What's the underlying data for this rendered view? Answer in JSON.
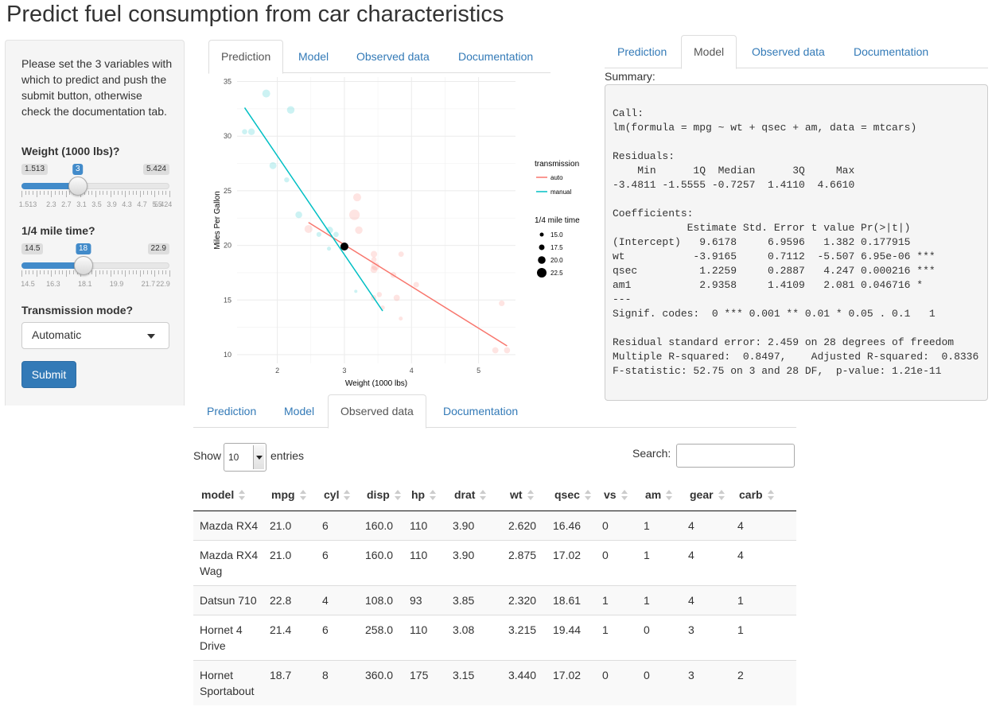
{
  "title": "Predict fuel consumption from car characteristics",
  "sidebar": {
    "intro": "Please set the 3 variables with which to predict and push the submit button, otherwise check the documentation tab.",
    "weight": {
      "label": "Weight (1000 lbs)?",
      "min": 1.513,
      "max": 5.424,
      "value": 3,
      "min_label": "1.513",
      "max_label": "5.424",
      "value_label": "3",
      "grid_labels": [
        "1.513",
        "2.3",
        "2.7",
        "3.1",
        "3.5",
        "3.9",
        "4.3",
        "4.7",
        "5.5",
        "5.424"
      ],
      "grid_positions": [
        1.513,
        2.3,
        2.7,
        3.1,
        3.5,
        3.9,
        4.3,
        4.7,
        5.1,
        5.424
      ]
    },
    "qsec": {
      "label": "1/4 mile time?",
      "min": 14.5,
      "max": 22.9,
      "value": 18,
      "min_label": "14.5",
      "max_label": "22.9",
      "value_label": "18",
      "grid_labels": [
        "14.5",
        "16.3",
        "18.1",
        "19.9",
        "21.7",
        "22.9"
      ],
      "grid_positions": [
        14.5,
        16.3,
        18.1,
        19.9,
        21.7,
        22.9
      ]
    },
    "transmission": {
      "label": "Transmission mode?",
      "selected": "Automatic"
    },
    "submit_label": "Submit"
  },
  "tabs": {
    "labels": [
      "Prediction",
      "Model",
      "Observed data",
      "Documentation"
    ]
  },
  "chart_data": {
    "type": "scatter",
    "xlabel": "Weight (1000 lbs)",
    "ylabel": "Miles Per Gallon",
    "xlim": [
      1.4,
      5.55
    ],
    "ylim": [
      9.2,
      35.4
    ],
    "x_ticks": [
      2,
      3,
      4,
      5
    ],
    "y_ticks": [
      10,
      15,
      20,
      25,
      30,
      35
    ],
    "grid": true,
    "legend_placement": "right",
    "legend": {
      "color_title": "transmission",
      "color_entries": [
        {
          "label": "auto",
          "color": "#f8766d"
        },
        {
          "label": "manual",
          "color": "#00bfc4"
        }
      ],
      "size_title": "1/4 mile time",
      "size_entries": [
        "15.0",
        "17.5",
        "20.0",
        "22.5"
      ]
    },
    "series": [
      {
        "name": "auto",
        "color": "#f8766d",
        "points": [
          [
            3.215,
            21.4,
            19.44
          ],
          [
            3.44,
            18.7,
            17.02
          ],
          [
            3.46,
            18.1,
            20.22
          ],
          [
            3.57,
            14.3,
            15.84
          ],
          [
            3.19,
            24.4,
            20.0
          ],
          [
            3.15,
            22.8,
            22.9
          ],
          [
            3.44,
            19.2,
            18.3
          ],
          [
            3.44,
            17.8,
            18.9
          ],
          [
            4.07,
            16.4,
            17.4
          ],
          [
            3.73,
            17.3,
            17.6
          ],
          [
            3.78,
            15.2,
            18.0
          ],
          [
            5.25,
            10.4,
            17.98
          ],
          [
            5.424,
            10.4,
            17.82
          ],
          [
            5.345,
            14.7,
            17.42
          ],
          [
            2.465,
            21.5,
            20.01
          ],
          [
            3.52,
            15.5,
            16.87
          ],
          [
            3.435,
            15.2,
            17.3
          ],
          [
            3.84,
            13.3,
            15.41
          ],
          [
            3.845,
            19.2,
            17.05
          ]
        ],
        "fit": [
          [
            2.465,
            22.1
          ],
          [
            5.424,
            10.8
          ]
        ]
      },
      {
        "name": "manual",
        "color": "#00bfc4",
        "points": [
          [
            2.62,
            21.0,
            16.46
          ],
          [
            2.875,
            21.0,
            17.02
          ],
          [
            2.32,
            22.8,
            18.61
          ],
          [
            2.2,
            32.4,
            19.47
          ],
          [
            1.615,
            30.4,
            18.52
          ],
          [
            1.835,
            33.9,
            19.9
          ],
          [
            1.935,
            27.3,
            18.9
          ],
          [
            2.14,
            26.0,
            16.7
          ],
          [
            1.513,
            30.4,
            16.9
          ],
          [
            3.17,
            15.8,
            14.5
          ],
          [
            2.77,
            19.7,
            15.5
          ],
          [
            2.78,
            21.4,
            18.6
          ]
        ],
        "fit": [
          [
            1.513,
            32.6
          ],
          [
            3.57,
            14.0
          ]
        ]
      }
    ],
    "prediction": {
      "wt": 3,
      "mpg": 19.9,
      "color": "#000000"
    }
  },
  "model": {
    "summary_label": "Summary:",
    "output": "\nCall:\nlm(formula = mpg ~ wt + qsec + am, data = mtcars)\n\nResiduals:\n    Min      1Q  Median      3Q     Max \n-3.4811 -1.5555 -0.7257  1.4110  4.6610 \n\nCoefficients:\n            Estimate Std. Error t value Pr(>|t|)    \n(Intercept)   9.6178     6.9596   1.382 0.177915    \nwt           -3.9165     0.7112  -5.507 6.95e-06 ***\nqsec          1.2259     0.2887   4.247 0.000216 ***\nam1           2.9358     1.4109   2.081 0.046716 *  \n---\nSignif. codes:  0 *** 0.001 ** 0.01 * 0.05 . 0.1   1\n\nResidual standard error: 2.459 on 28 degrees of freedom\nMultiple R-squared:  0.8497,\tAdjusted R-squared:  0.8336 \nF-statistic: 52.75 on 3 and 28 DF,  p-value: 1.21e-11"
  },
  "datatable": {
    "show_label": "Show",
    "length_value": "10",
    "entries_label": "entries",
    "search_label": "Search:",
    "columns": [
      "model",
      "mpg",
      "cyl",
      "disp",
      "hp",
      "drat",
      "wt",
      "qsec",
      "vs",
      "am",
      "gear",
      "carb"
    ],
    "rows": [
      [
        "Mazda RX4",
        "21.0",
        "6",
        "160.0",
        "110",
        "3.90",
        "2.620",
        "16.46",
        "0",
        "1",
        "4",
        "4"
      ],
      [
        "Mazda RX4 Wag",
        "21.0",
        "6",
        "160.0",
        "110",
        "3.90",
        "2.875",
        "17.02",
        "0",
        "1",
        "4",
        "4"
      ],
      [
        "Datsun 710",
        "22.8",
        "4",
        "108.0",
        "93",
        "3.85",
        "2.320",
        "18.61",
        "1",
        "1",
        "4",
        "1"
      ],
      [
        "Hornet 4 Drive",
        "21.4",
        "6",
        "258.0",
        "110",
        "3.08",
        "3.215",
        "19.44",
        "1",
        "0",
        "3",
        "1"
      ],
      [
        "Hornet Sportabout",
        "18.7",
        "8",
        "360.0",
        "175",
        "3.15",
        "3.440",
        "17.02",
        "0",
        "0",
        "3",
        "2"
      ]
    ]
  }
}
